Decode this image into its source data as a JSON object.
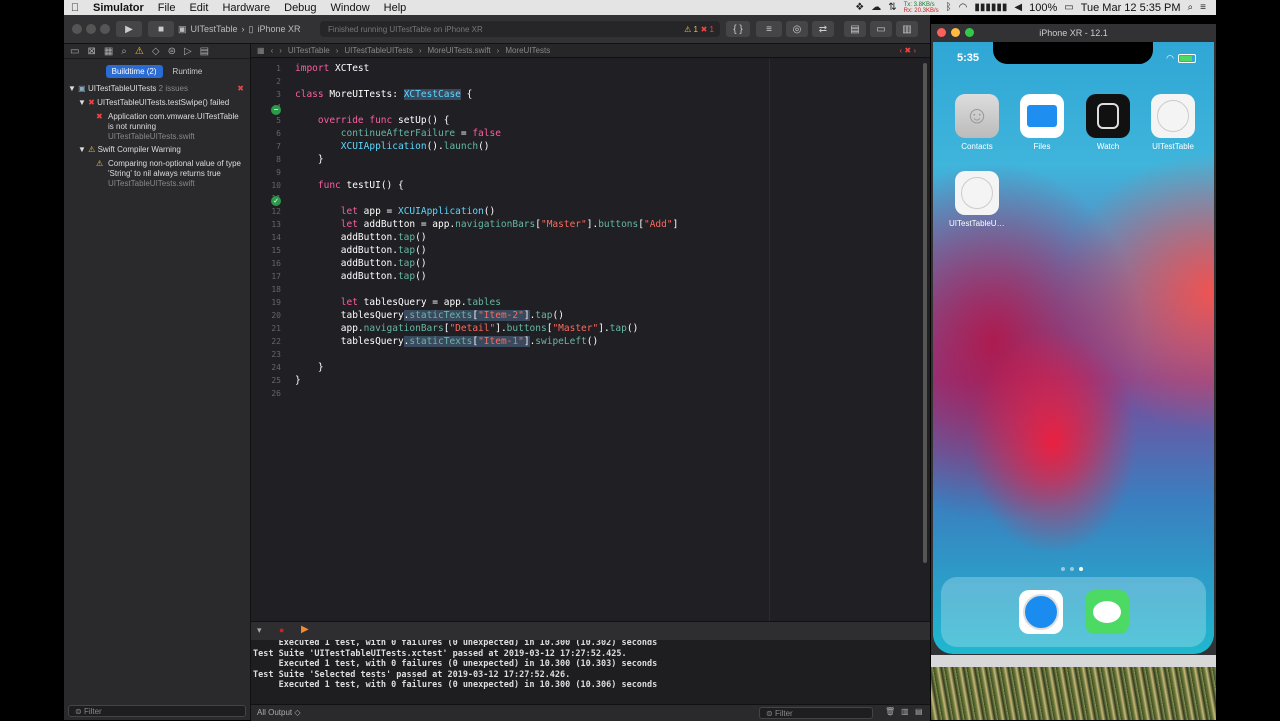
{
  "menubar": {
    "items": [
      "Simulator",
      "File",
      "Edit",
      "Hardware",
      "Debug",
      "Window",
      "Help"
    ],
    "net_tx": "Tx: 3.8KB/s",
    "net_rx": "Rx: 20.3KB/s",
    "battery": "100%",
    "datetime": "Tue Mar 12  5:35 PM"
  },
  "toolbar": {
    "scheme": "UITestTable",
    "device": "iPhone XR",
    "activity": "Finished running UITestTable on iPhone XR",
    "warn_count": "1",
    "err_count": "1"
  },
  "navigator": {
    "tabs": [
      "Buildtime (2)",
      "Runtime"
    ],
    "project": "UITestTableUITests",
    "project_count": "2 issues",
    "test_failure": "UITestTableUITests.testSwipe() failed",
    "error_msg_1": "Application com.vmware.UITestTable",
    "error_msg_2": "is not running",
    "error_file": "UITestTableUITests.swift",
    "warning_group": "Swift Compiler Warning",
    "warning_msg_1": "Comparing non-optional value of type",
    "warning_msg_2": "'String' to nil always returns true",
    "warning_file": "UITestTableUITests.swift",
    "filter_placeholder": "Filter"
  },
  "jumpbar": {
    "path": [
      "UITestTable",
      "UITestTableUITests",
      "MoreUITests.swift",
      "MoreUITests"
    ]
  },
  "code": {
    "line_numbers": [
      "1",
      "2",
      "3",
      "4",
      "5",
      "6",
      "7",
      "8",
      "9",
      "10",
      "11",
      "12",
      "13",
      "14",
      "15",
      "16",
      "17",
      "18",
      "19",
      "20",
      "21",
      "22",
      "23",
      "24",
      "25",
      "26"
    ]
  },
  "console": {
    "lines": [
      "     Executed 1 test, with 0 failures (0 unexpected) in 10.300 (10.302) seconds",
      "Test Suite 'UITestTableUITests.xctest' passed at 2019-03-12 17:27:52.425.",
      "     Executed 1 test, with 0 failures (0 unexpected) in 10.300 (10.303) seconds",
      "Test Suite 'Selected tests' passed at 2019-03-12 17:27:52.426.",
      "     Executed 1 test, with 0 failures (0 unexpected) in 10.300 (10.306) seconds"
    ],
    "output_selector": "All Output ◇",
    "filter_placeholder": "Filter"
  },
  "simulator": {
    "title": "iPhone XR - 12.1",
    "time": "5:35",
    "apps": [
      "Contacts",
      "Files",
      "Watch",
      "UITestTable",
      "UITestTableUITe..."
    ]
  }
}
